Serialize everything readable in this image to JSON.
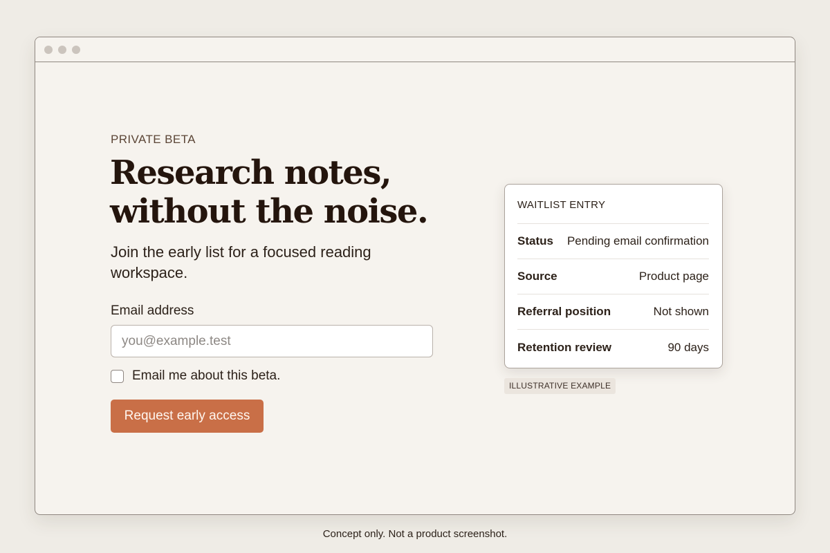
{
  "hero": {
    "eyebrow": "PRIVATE BETA",
    "headline_line1": "Research notes,",
    "headline_line2": "without the noise.",
    "subhead": "Join the early list for a focused reading workspace."
  },
  "form": {
    "email_label": "Email address",
    "email_placeholder": "you@example.test",
    "email_value": "",
    "opt_in_label": "Email me about this beta.",
    "opt_in_checked": false,
    "submit_label": "Request early access"
  },
  "waitlist_card": {
    "title": "WAITLIST ENTRY",
    "rows": [
      {
        "key": "Status",
        "value": "Pending email confirmation"
      },
      {
        "key": "Source",
        "value": "Product page"
      },
      {
        "key": "Referral position",
        "value": "Not shown"
      },
      {
        "key": "Retention review",
        "value": "90 days"
      }
    ],
    "tag": "ILLUSTRATIVE EXAMPLE"
  },
  "footer": {
    "note": "Concept only. Not a product screenshot."
  },
  "colors": {
    "accent": "#c96f47",
    "page_background": "#efece6",
    "window_background": "#f6f3ee",
    "text": "#2c2119",
    "headline": "#24150d"
  }
}
